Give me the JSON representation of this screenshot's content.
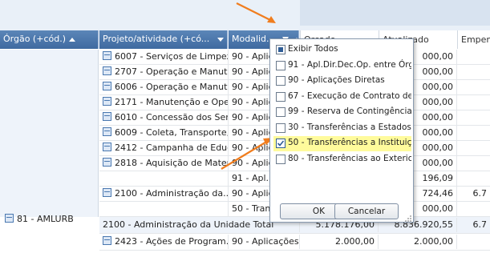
{
  "headers": {
    "orgao": "Órgão (+cód.)",
    "projeto": "Projeto/atividade (+có...",
    "modalidade": "Modalid...",
    "orcado": "Orçado",
    "atualizado": "Atualizado",
    "empenhado": "Empenh"
  },
  "org_label": "81 - AMLURB",
  "rows": [
    {
      "projeto": "6007 - Serviços de Limpez...",
      "mod": "90 - Aplica",
      "atual": "000,00",
      "emp": ""
    },
    {
      "projeto": "2707 - Operação e Manut...",
      "mod": "90 - Aplica",
      "atual": "000,00",
      "emp": ""
    },
    {
      "projeto": "6006 - Operação e Manut...",
      "mod": "90 - Aplica",
      "atual": "000,00",
      "emp": ""
    },
    {
      "projeto": "2171 - Manutenção e Ope...",
      "mod": "90 - Aplica",
      "atual": "000,00",
      "emp": ""
    },
    {
      "projeto": "6010 - Concessão dos Ser...",
      "mod": "90 - Aplica",
      "atual": "000,00",
      "emp": ""
    },
    {
      "projeto": "6009 - Coleta, Transporte,...",
      "mod": "90 - Aplica",
      "atual": "000,00",
      "emp": ""
    },
    {
      "projeto": "2412 - Campanha de Educ...",
      "mod": "90 - Aplica",
      "atual": "000,00",
      "emp": ""
    },
    {
      "projeto": "2818 - Aquisição de Mater...",
      "mod": "90 - Aplica",
      "atual": "000,00",
      "emp": ""
    },
    {
      "projeto": "",
      "mod": "91 - Apl.D",
      "atual": "196,09",
      "emp": ""
    },
    {
      "projeto": "2100 - Administração da...",
      "mod": "90 - Aplica",
      "atual": "724,46",
      "emp": "6.7"
    },
    {
      "projeto": "",
      "mod": "50 - Transf",
      "atual": "000,00",
      "emp": ""
    }
  ],
  "total_row": {
    "label": "2100 - Administração da Unidade Total",
    "orcado": "5.178.176,00",
    "atualizado": "8.836.920,55",
    "emp": "6.7"
  },
  "last_row": {
    "projeto": "2423 - Ações de Program...",
    "mod": "90 - Aplicações...",
    "orcado": "2.000,00",
    "atualizado": "2.000,00"
  },
  "filter_menu": {
    "items": [
      {
        "label": "Exibir Todos",
        "state": "partial"
      },
      {
        "label": "91 - Apl.Dir.Dec.Op. entre Órgãos",
        "state": "unchecked"
      },
      {
        "label": "90 - Aplicações Diretas",
        "state": "unchecked"
      },
      {
        "label": "67 - Execução de Contrato de Par",
        "state": "unchecked"
      },
      {
        "label": "99 - Reserva de Contingência",
        "state": "unchecked"
      },
      {
        "label": "30 - Transferências a Estados e ao",
        "state": "unchecked"
      },
      {
        "label": "50 - Transferências a Instituições",
        "state": "checked"
      },
      {
        "label": "80 - Transferências ao Exterior",
        "state": "unchecked"
      }
    ],
    "ok_label": "OK",
    "cancel_label": "Cancelar"
  },
  "colors": {
    "arrow": "#f07d1e",
    "header": "#4b77ad",
    "highlight": "#fffb9c"
  }
}
